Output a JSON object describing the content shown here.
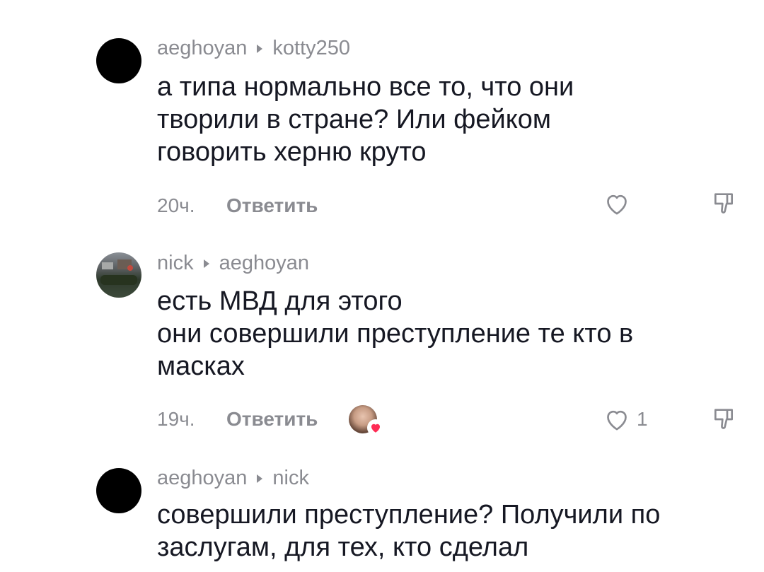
{
  "comments": [
    {
      "author": "aeghoyan",
      "reply_to": "kotty250",
      "lines": [
        "а типа нормально все то, что они",
        "творили в стране? Или фейком",
        "говорить херню круто"
      ],
      "time": "20ч.",
      "reply_label": "Ответить",
      "like_count": "",
      "avatar": "black-circle"
    },
    {
      "author": "nick",
      "reply_to": "aeghoyan",
      "lines": [
        "есть МВД для этого",
        "они совершили преступление те кто в",
        "масках"
      ],
      "time": "19ч.",
      "reply_label": "Ответить",
      "like_count": "1",
      "avatar": "photo",
      "creator_liked": true
    },
    {
      "author": "aeghoyan",
      "reply_to": "nick",
      "lines": [
        "совершили преступление? Получили по",
        "заслугам, для тех, кто сделал"
      ],
      "avatar": "black-circle"
    }
  ],
  "icons": {
    "like": "heart-outline-icon",
    "dislike": "thumbs-down-outline-icon",
    "reply_arrow": "caret-right-icon"
  },
  "colors": {
    "text": "#161823",
    "secondary": "#8a8b91",
    "heart_badge": "#fe2c55"
  }
}
